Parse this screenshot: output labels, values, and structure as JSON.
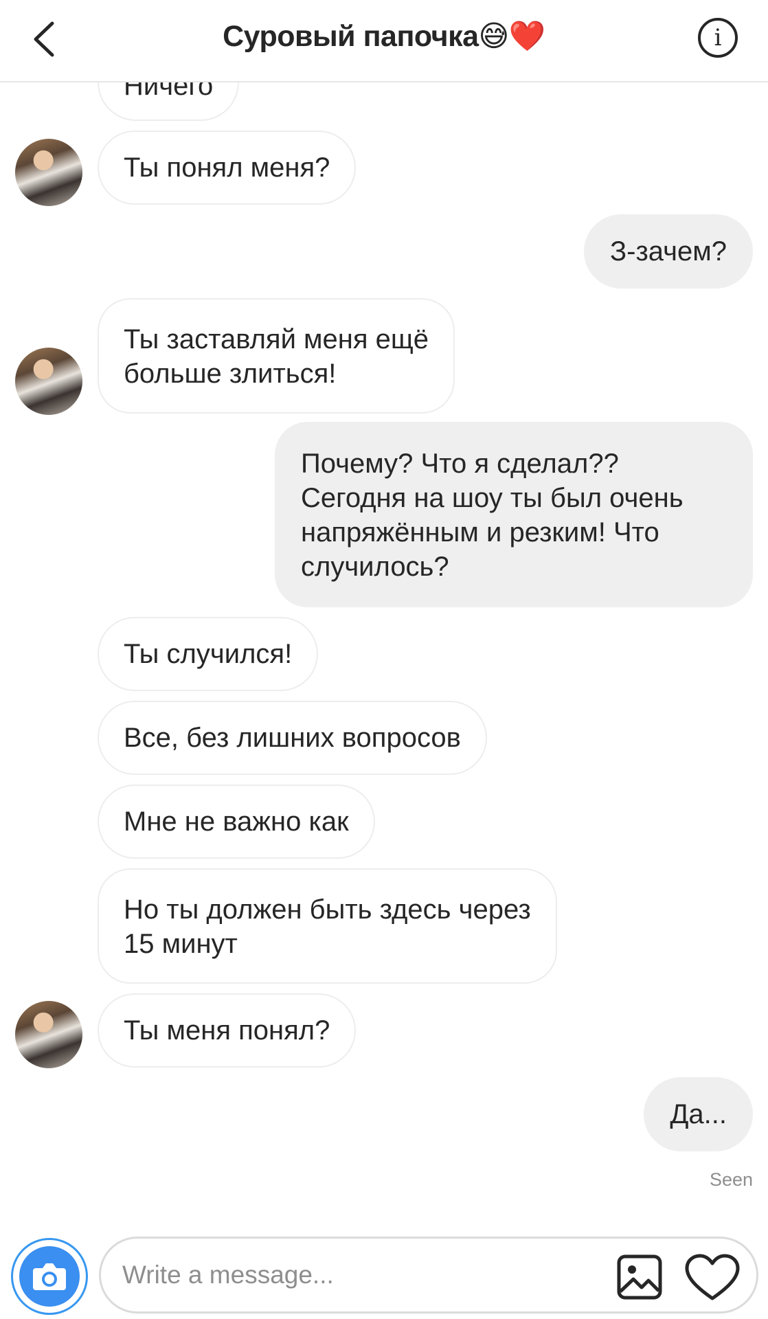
{
  "header": {
    "title": "Суровый папочка😅❤️",
    "back_icon": "chevron-left-icon",
    "info_icon": "info-icon",
    "info_glyph": "i"
  },
  "messages": [
    {
      "from": "them",
      "lines": [
        "Ничего"
      ]
    },
    {
      "from": "them",
      "lines": [
        "Ты понял меня?"
      ]
    },
    {
      "from": "me",
      "lines": [
        "З-зачем?"
      ]
    },
    {
      "from": "them",
      "lines": [
        "Ты заставляй меня ещё",
        "больше злиться!"
      ]
    },
    {
      "from": "me",
      "lines": [
        "Почему? Что я сделал??",
        "Сегодня на шоу ты был очень",
        "напряжённым и резким! Что",
        "случилось?"
      ]
    },
    {
      "from": "them",
      "lines": [
        "Ты случился!"
      ]
    },
    {
      "from": "them",
      "lines": [
        "Все, без лишних вопросов"
      ]
    },
    {
      "from": "them",
      "lines": [
        "Мне не важно как"
      ]
    },
    {
      "from": "them",
      "lines": [
        "Но ты должен быть здесь через",
        "15 минут"
      ]
    },
    {
      "from": "them",
      "lines": [
        "Ты меня понял?"
      ]
    },
    {
      "from": "me",
      "lines": [
        "Да..."
      ]
    }
  ],
  "status": {
    "seen": "Seen"
  },
  "composer": {
    "placeholder": "Write a message...",
    "camera_icon": "camera-icon",
    "gallery_icon": "gallery-icon",
    "like_icon": "heart-icon"
  },
  "colors": {
    "accent": "#3797f0",
    "outgoing_bubble": "#efefef",
    "text": "#262626",
    "muted": "#8e8e8e"
  }
}
